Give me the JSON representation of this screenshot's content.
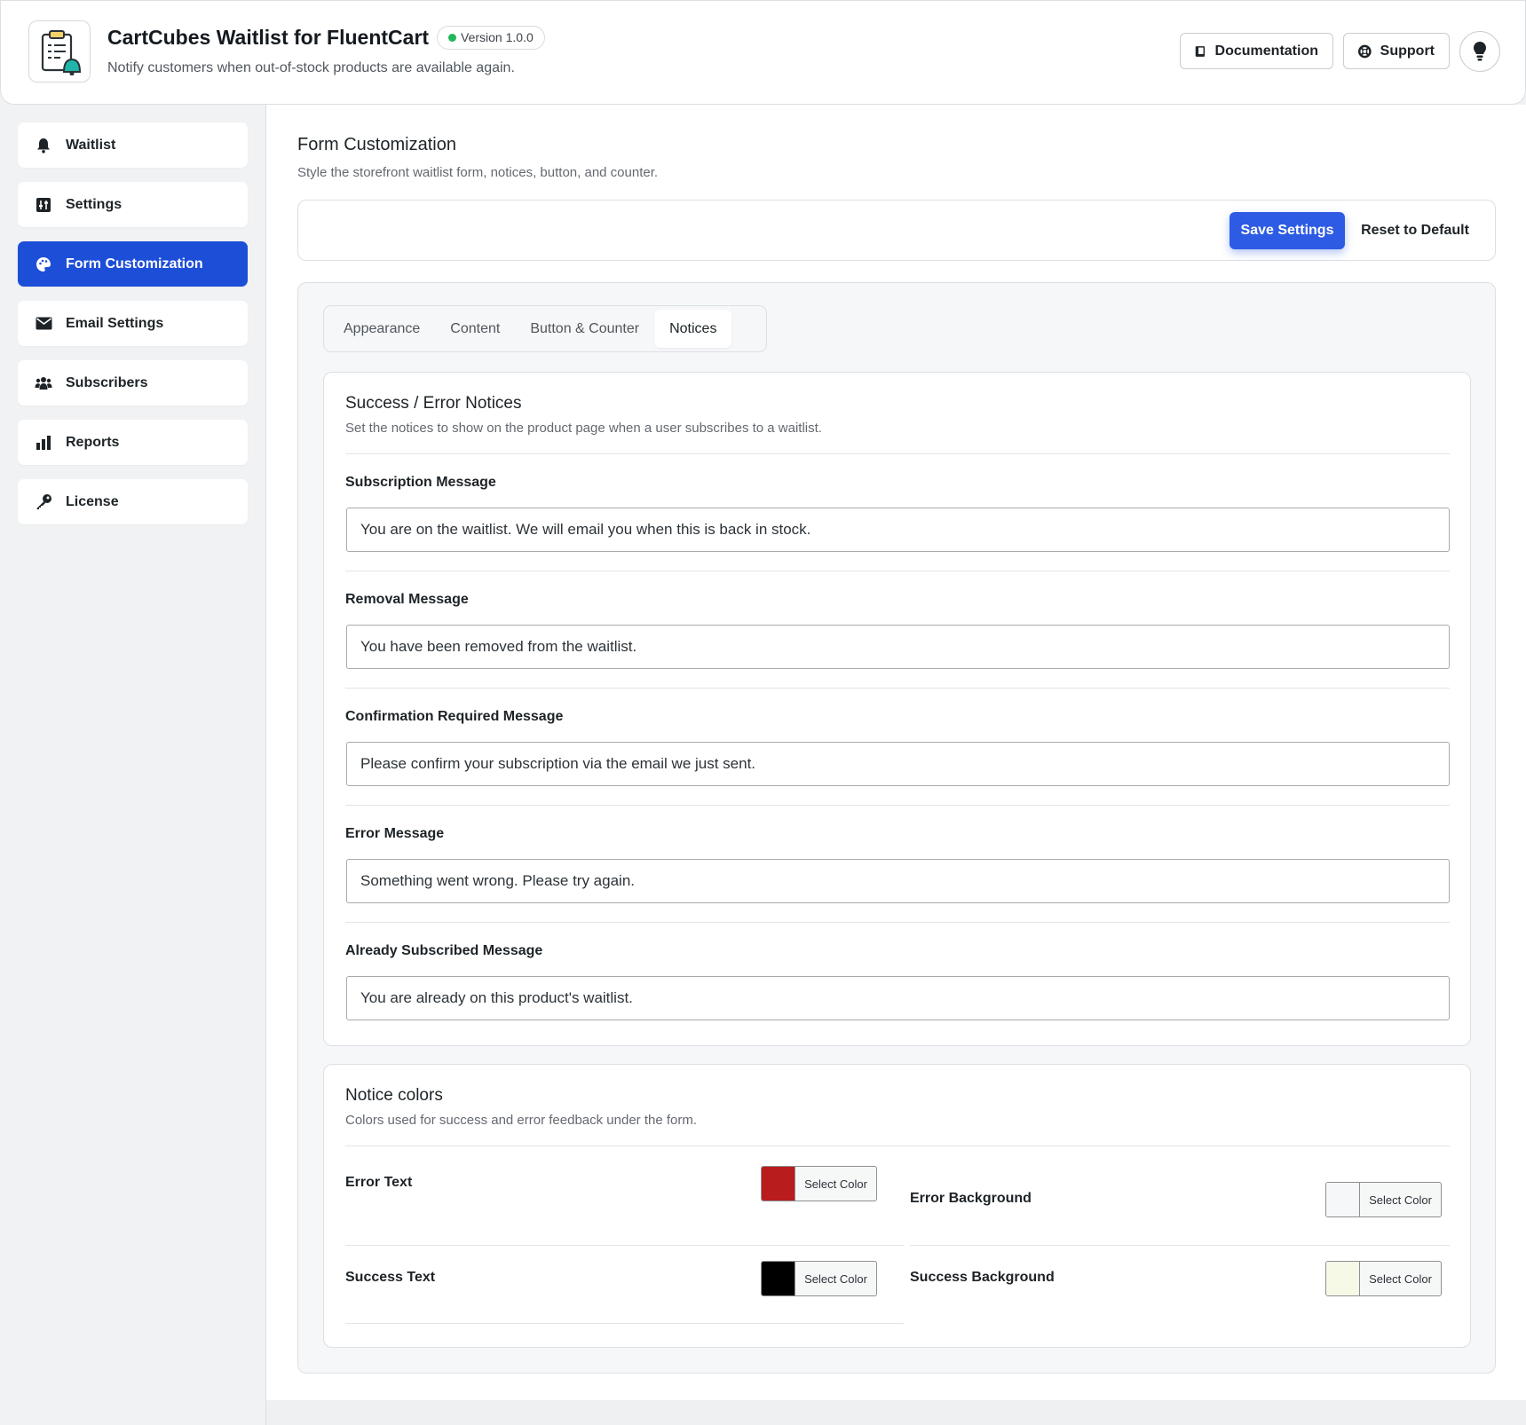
{
  "header": {
    "title": "CartCubes Waitlist for FluentCart",
    "version": "Version 1.0.0",
    "subtitle": "Notify customers when out-of-stock products are available again.",
    "documentation_label": "Documentation",
    "support_label": "Support"
  },
  "sidebar": {
    "items": [
      {
        "label": "Waitlist",
        "icon": "bell-icon"
      },
      {
        "label": "Settings",
        "icon": "sliders-icon"
      },
      {
        "label": "Form Customization",
        "icon": "palette-icon",
        "active": true
      },
      {
        "label": "Email Settings",
        "icon": "envelope-icon"
      },
      {
        "label": "Subscribers",
        "icon": "users-icon"
      },
      {
        "label": "Reports",
        "icon": "bar-chart-icon"
      },
      {
        "label": "License",
        "icon": "key-icon"
      }
    ]
  },
  "main": {
    "title": "Form Customization",
    "subtitle": "Style the storefront waitlist form, notices, button, and counter.",
    "save_label": "Save Settings",
    "reset_label": "Reset to Default",
    "tabs": [
      {
        "label": "Appearance"
      },
      {
        "label": "Content"
      },
      {
        "label": "Button & Counter"
      },
      {
        "label": "Notices",
        "active": true
      }
    ]
  },
  "notices": {
    "title": "Success / Error Notices",
    "subtitle": "Set the notices to show on the product page when a user subscribes to a waitlist.",
    "fields": [
      {
        "label": "Subscription Message",
        "value": "You are on the waitlist. We will email you when this is back in stock."
      },
      {
        "label": "Removal Message",
        "value": "You have been removed from the waitlist."
      },
      {
        "label": "Confirmation Required Message",
        "value": "Please confirm your subscription via the email we just sent."
      },
      {
        "label": "Error Message",
        "value": "Something went wrong. Please try again."
      },
      {
        "label": "Already Subscribed Message",
        "value": "You are already on this product's waitlist."
      }
    ]
  },
  "colors": {
    "title": "Notice colors",
    "subtitle": "Colors used for success and error feedback under the form.",
    "select_label": "Select Color",
    "items": [
      {
        "label": "Error Text",
        "color": "#b91c1c"
      },
      {
        "label": "Error Background",
        "color": "#f6f7f8"
      },
      {
        "label": "Success Text",
        "color": "#000000"
      },
      {
        "label": "Success Background",
        "color": "#f5f9e6"
      }
    ]
  },
  "theme": {
    "accent": "#1d4ed8",
    "save_button": "#2d5be3",
    "status_dot": "#1fb85a"
  }
}
